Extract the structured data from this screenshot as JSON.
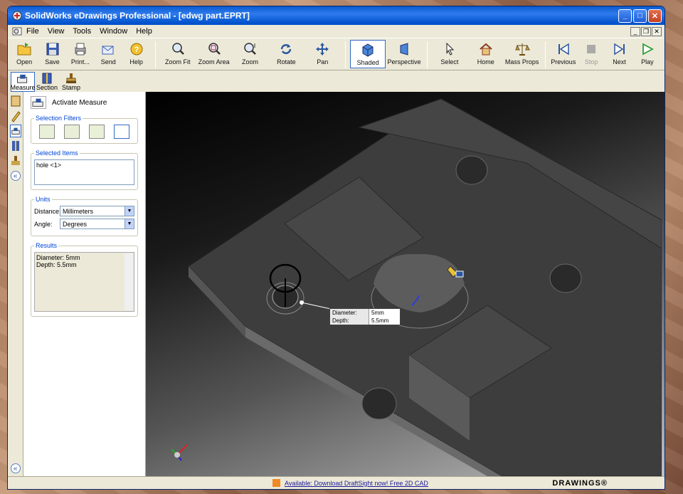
{
  "window": {
    "title": "SolidWorks eDrawings Professional - [edwg part.EPRT]"
  },
  "menu": [
    "File",
    "View",
    "Tools",
    "Window",
    "Help"
  ],
  "toolbar": [
    {
      "label": "Open",
      "icon": "open-folder-icon"
    },
    {
      "label": "Save",
      "icon": "save-disk-icon"
    },
    {
      "label": "Print...",
      "icon": "printer-icon"
    },
    {
      "label": "Send",
      "icon": "send-mail-icon"
    },
    {
      "label": "Help",
      "icon": "help-icon"
    },
    {
      "label": "Zoom Fit",
      "icon": "zoom-fit-icon"
    },
    {
      "label": "Zoom Area",
      "icon": "zoom-area-icon"
    },
    {
      "label": "Zoom",
      "icon": "zoom-icon"
    },
    {
      "label": "Rotate",
      "icon": "rotate-icon"
    },
    {
      "label": "Pan",
      "icon": "pan-icon"
    },
    {
      "label": "Shaded",
      "icon": "shaded-cube-icon"
    },
    {
      "label": "Perspective",
      "icon": "perspective-icon"
    },
    {
      "label": "Select",
      "icon": "select-arrow-icon"
    },
    {
      "label": "Home",
      "icon": "home-icon"
    },
    {
      "label": "Mass Props",
      "icon": "scales-icon"
    },
    {
      "label": "Previous",
      "icon": "previous-icon"
    },
    {
      "label": "Stop",
      "icon": "stop-icon"
    },
    {
      "label": "Next",
      "icon": "next-icon"
    },
    {
      "label": "Play",
      "icon": "play-icon"
    }
  ],
  "toolbar2": [
    {
      "label": "Measure",
      "icon": "measure-icon"
    },
    {
      "label": "Section",
      "icon": "section-icon"
    },
    {
      "label": "Stamp",
      "icon": "stamp-icon"
    }
  ],
  "panel": {
    "header": "Activate Measure",
    "selection_filters_label": "Selection Filters",
    "selected_items_label": "Selected Items",
    "selected_item": "hole <1>",
    "units_label": "Units",
    "distance_label": "Distance:",
    "distance_value": "Millimeters",
    "angle_label": "Angle:",
    "angle_value": "Degrees",
    "results_label": "Results",
    "results_line1": "Diameter: 5mm",
    "results_line2": "Depth: 5.5mm"
  },
  "tooltip": {
    "diameter_label": "Diameter:",
    "diameter_value": "5mm",
    "depth_label": "Depth:",
    "depth_value": "5.5mm"
  },
  "status": {
    "link": "Available: Download DraftSight now! Free 2D CAD",
    "brand": "DRAWINGS®"
  },
  "colors": {
    "title_blue": "#0a5cd0",
    "accent": "#316ac5"
  }
}
